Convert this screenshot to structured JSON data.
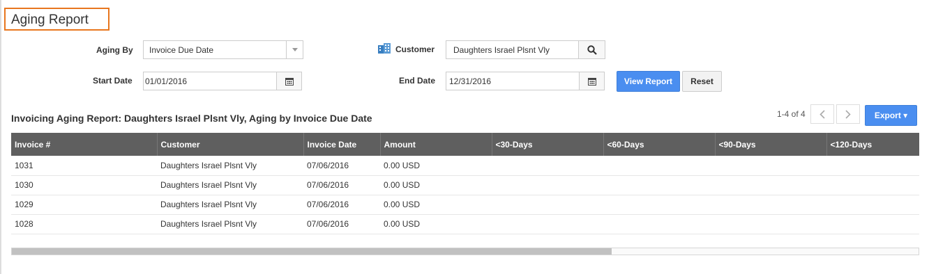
{
  "page": {
    "title": "Aging Report"
  },
  "filters": {
    "aging_by_label": "Aging By",
    "aging_by_value": "Invoice Due Date",
    "customer_label": "Customer",
    "customer_value": "Daughters Israel Plsnt Vly",
    "start_date_label": "Start Date",
    "start_date_value": "01/01/2016",
    "end_date_label": "End Date",
    "end_date_value": "12/31/2016"
  },
  "actions": {
    "view_report": "View Report",
    "reset": "Reset",
    "export": "Export ▾"
  },
  "report": {
    "title": "Invoicing Aging Report: Daughters Israel Plsnt Vly, Aging by Invoice Due Date"
  },
  "pager": {
    "text": "1-4 of 4"
  },
  "table": {
    "columns": [
      "Invoice #",
      "Customer",
      "Invoice Date",
      "Amount",
      "<30-Days",
      "<60-Days",
      "<90-Days",
      "<120-Days"
    ],
    "rows": [
      [
        "1031",
        "Daughters Israel Plsnt Vly",
        "07/06/2016",
        "0.00 USD",
        "",
        "",
        "",
        ""
      ],
      [
        "1030",
        "Daughters Israel Plsnt Vly",
        "07/06/2016",
        "0.00 USD",
        "",
        "",
        "",
        ""
      ],
      [
        "1029",
        "Daughters Israel Plsnt Vly",
        "07/06/2016",
        "0.00 USD",
        "",
        "",
        "",
        ""
      ],
      [
        "1028",
        "Daughters Israel Plsnt Vly",
        "07/06/2016",
        "0.00 USD",
        "",
        "",
        "",
        ""
      ]
    ]
  },
  "icons": {
    "customer": "building-icon",
    "search": "search-icon",
    "calendar": "calendar-icon",
    "dropdown": "caret-down-icon",
    "prev": "chevron-left-icon",
    "next": "chevron-right-icon"
  },
  "colors": {
    "accent": "#4a8ef0",
    "title_border": "#e8761e",
    "table_header": "#5f5f5f"
  }
}
